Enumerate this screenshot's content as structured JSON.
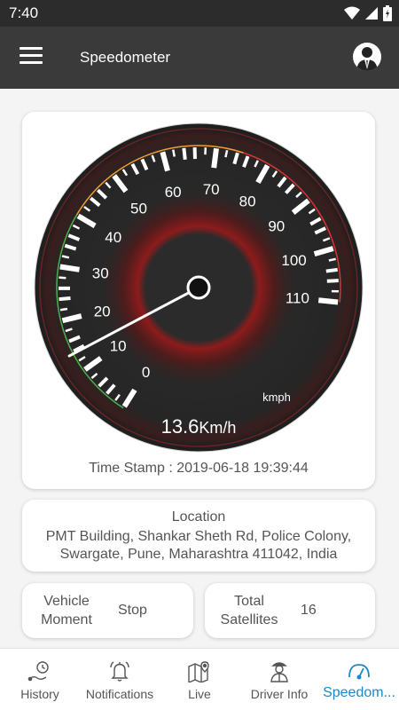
{
  "status_bar": {
    "time": "7:40"
  },
  "app_bar": {
    "title": "Speedometer"
  },
  "gauge": {
    "speed_value": "13.6",
    "speed_unit": "Km/h",
    "scale_unit": "kmph",
    "scale_labels": [
      "0",
      "10",
      "20",
      "30",
      "40",
      "50",
      "60",
      "70",
      "80",
      "90",
      "100",
      "110"
    ],
    "max_speed": 110,
    "current_speed": 13.6
  },
  "timestamp": "Time Stamp : 2019-06-18 19:39:44",
  "location": {
    "title": "Location",
    "address": "PMT Building, Shankar Sheth Rd, Police Colony, Swargate, Pune, Maharashtra 411042, India"
  },
  "vehicle": {
    "label": "Vehicle Moment",
    "value": "Stop"
  },
  "satellites": {
    "label": "Total Satellites",
    "value": "16"
  },
  "bottom_nav": [
    {
      "label": "History",
      "icon": "history-icon"
    },
    {
      "label": "Notifications",
      "icon": "bell-icon"
    },
    {
      "label": "Live",
      "icon": "map-icon"
    },
    {
      "label": "Driver Info",
      "icon": "driver-icon"
    },
    {
      "label": "Speedom...",
      "icon": "speedometer-icon",
      "active": true
    }
  ],
  "colors": {
    "accent": "#1e88c8",
    "app_bar": "#3a3a3a",
    "gauge_face": "#2a2a2a"
  }
}
